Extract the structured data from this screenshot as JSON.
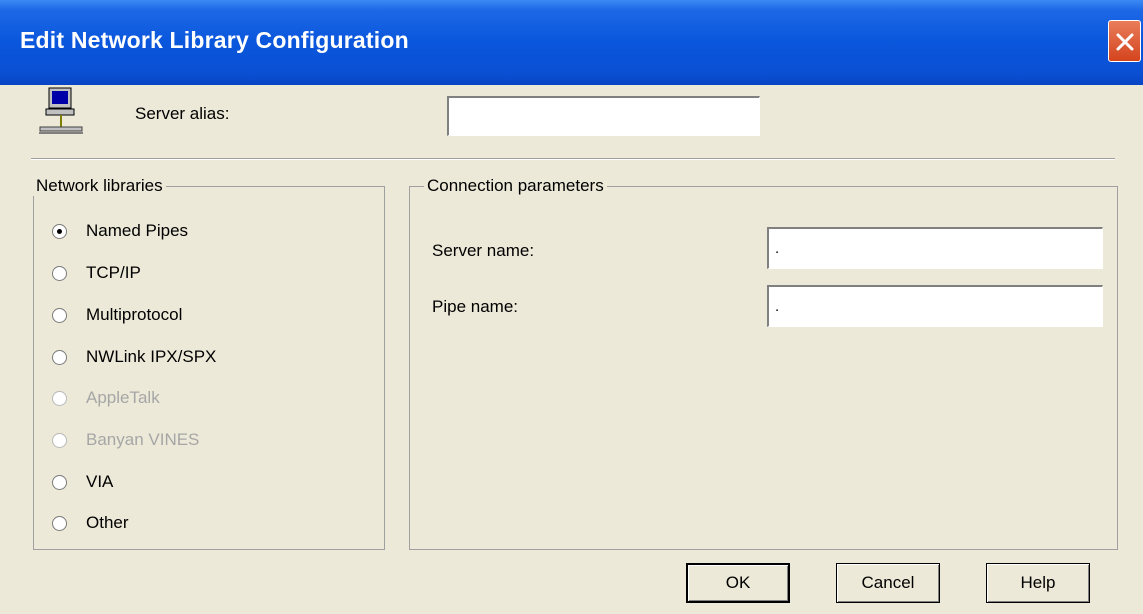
{
  "window": {
    "title": "Edit Network Library Configuration"
  },
  "alias": {
    "label": "Server alias:",
    "value": ""
  },
  "network_libraries": {
    "title": "Network libraries",
    "selected": "Named Pipes",
    "options": [
      {
        "label": "Named Pipes",
        "checked": true,
        "enabled": true
      },
      {
        "label": "TCP/IP",
        "checked": false,
        "enabled": true
      },
      {
        "label": "Multiprotocol",
        "checked": false,
        "enabled": true
      },
      {
        "label": "NWLink IPX/SPX",
        "checked": false,
        "enabled": true
      },
      {
        "label": "AppleTalk",
        "checked": false,
        "enabled": false
      },
      {
        "label": "Banyan VINES",
        "checked": false,
        "enabled": false
      },
      {
        "label": "VIA",
        "checked": false,
        "enabled": true
      },
      {
        "label": "Other",
        "checked": false,
        "enabled": true
      }
    ]
  },
  "connection_parameters": {
    "title": "Connection parameters",
    "server_name": {
      "label": "Server name:",
      "value": "."
    },
    "pipe_name": {
      "label": "Pipe name:",
      "value": "."
    }
  },
  "buttons": {
    "ok": "OK",
    "cancel": "Cancel",
    "help": "Help"
  },
  "icons": {
    "computer": "network-computer-icon",
    "close": "close-icon"
  }
}
